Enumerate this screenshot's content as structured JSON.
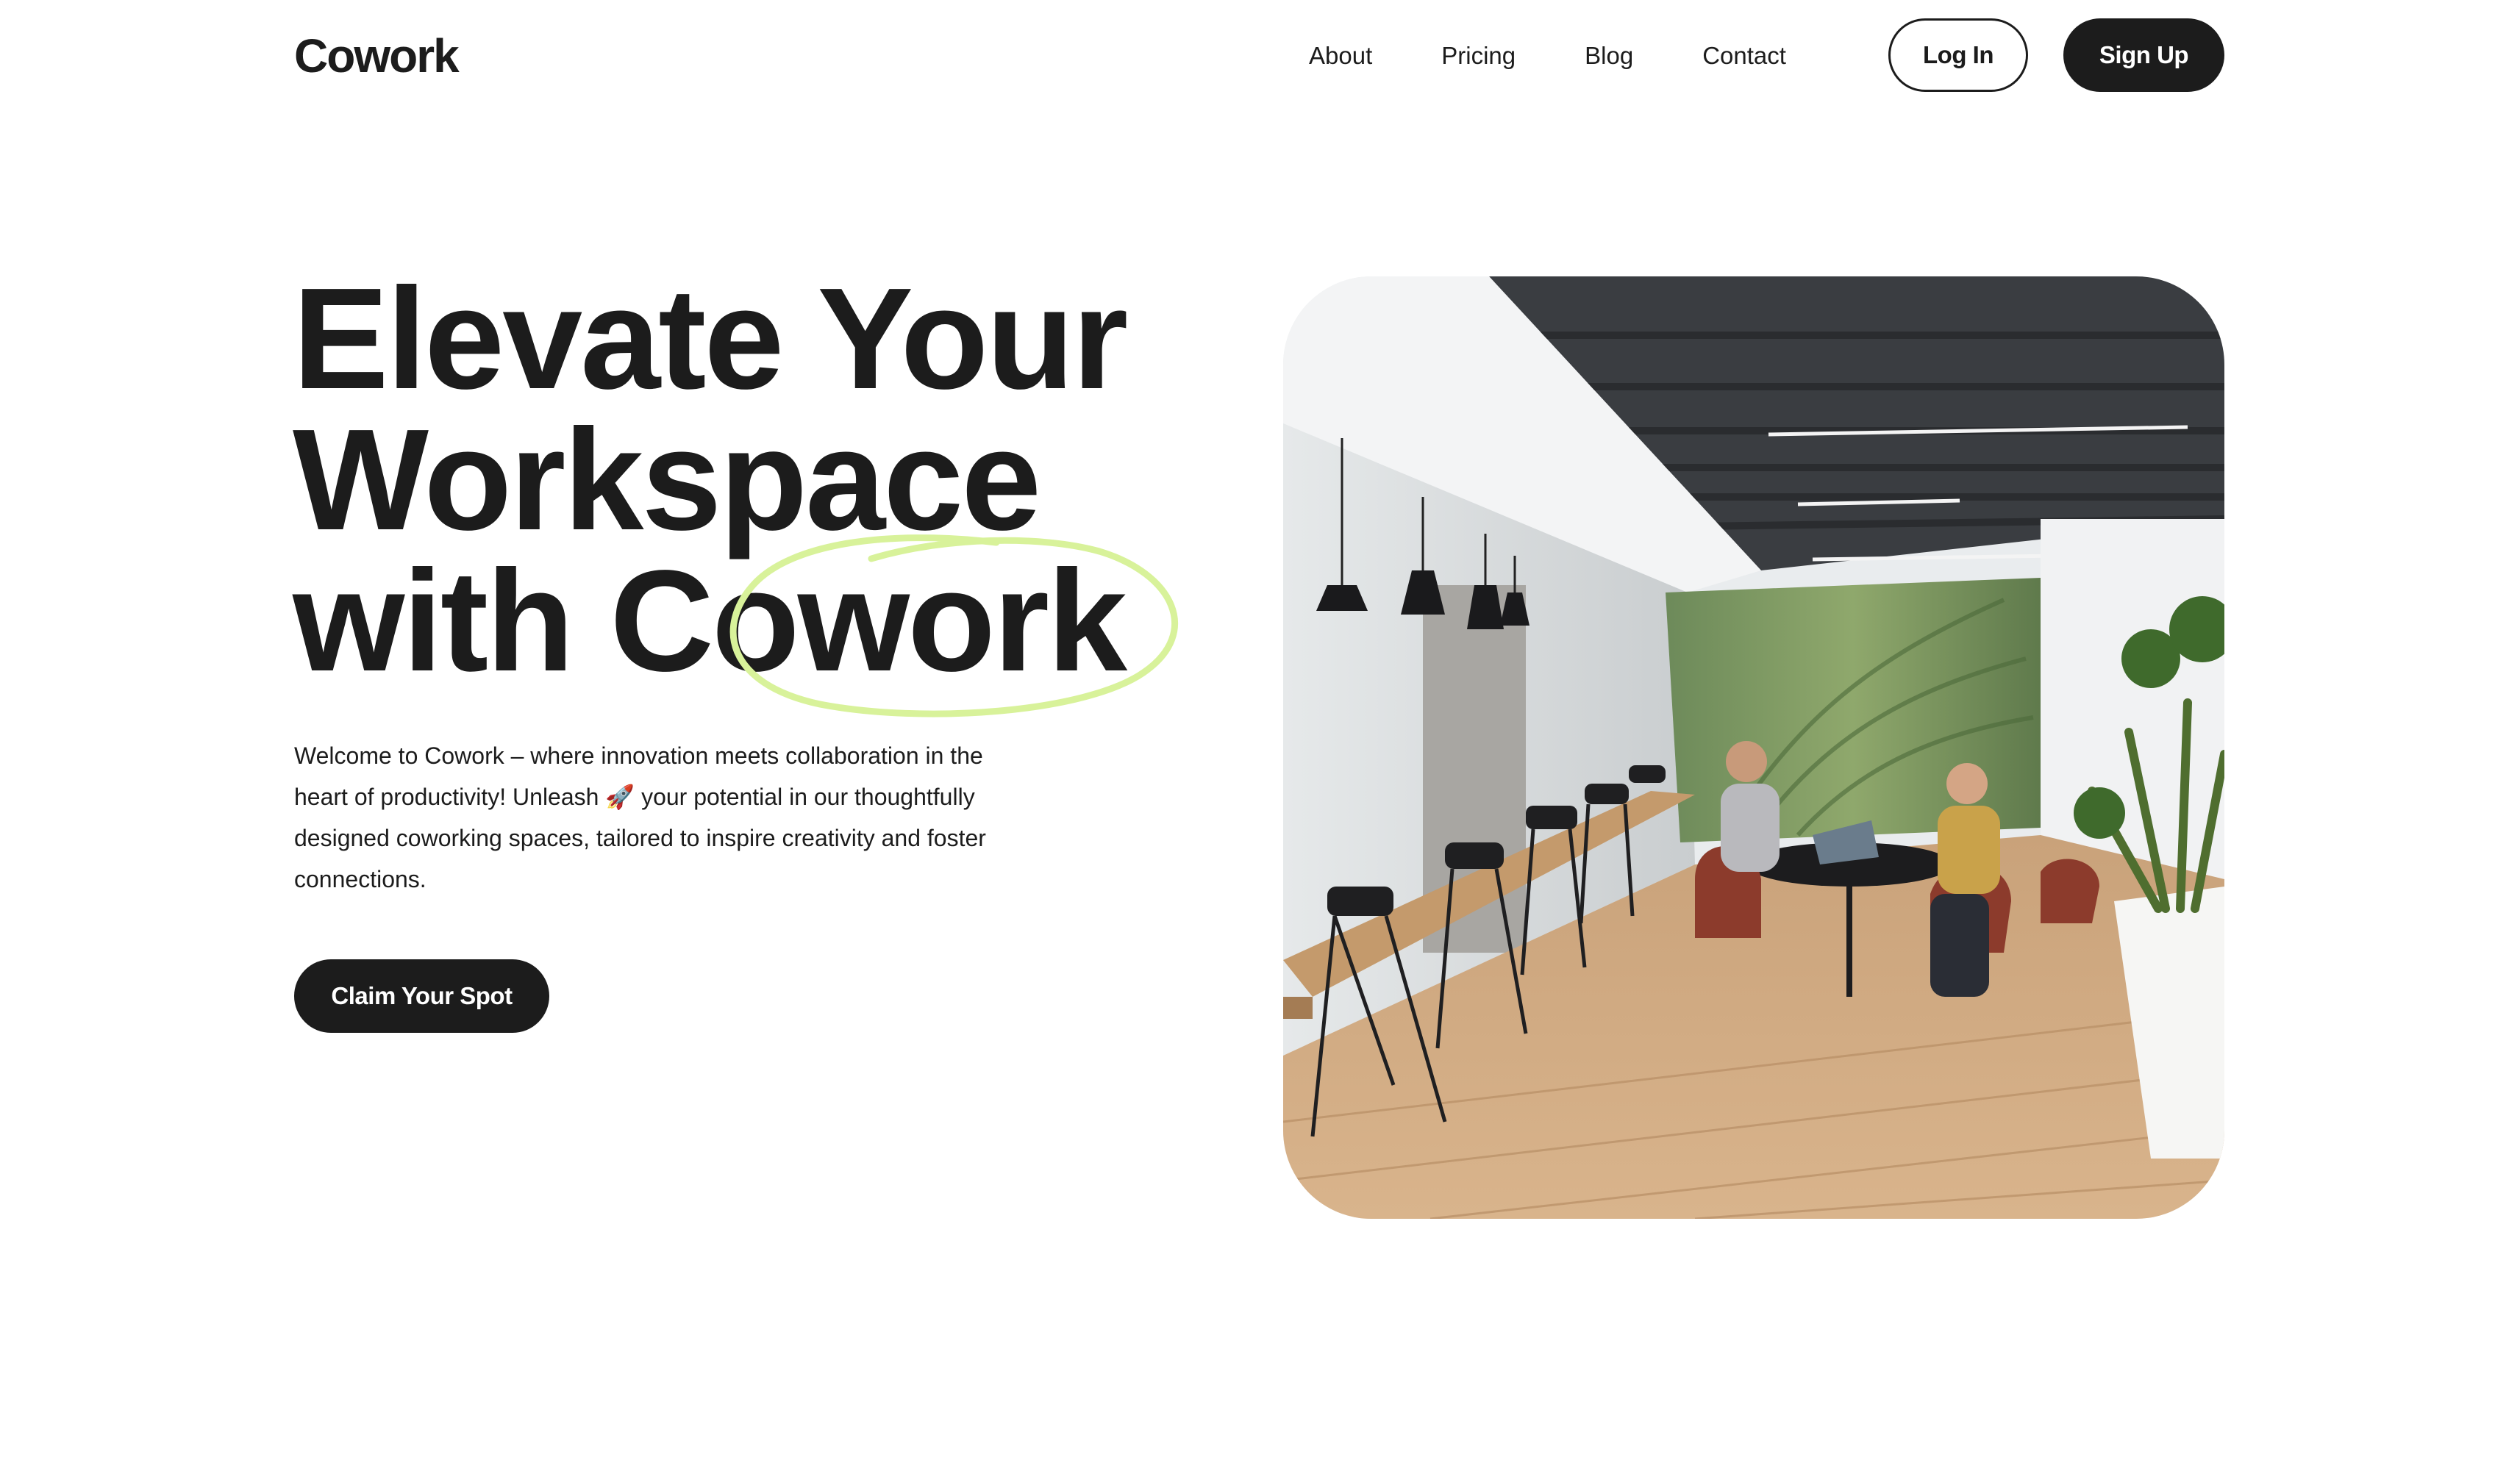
{
  "brand": {
    "name": "Cowork"
  },
  "nav": {
    "links": [
      {
        "label": "About"
      },
      {
        "label": "Pricing"
      },
      {
        "label": "Blog"
      },
      {
        "label": "Contact"
      }
    ],
    "login_label": "Log In",
    "signup_label": "Sign Up"
  },
  "hero": {
    "headline_line1": "Elevate Your",
    "headline_line2": "Workspace",
    "headline_line3_prefix": "with ",
    "headline_line3_highlight": "Cowork",
    "description": "Welcome to Cowork – where innovation meets collaboration in the heart of productivity! Unleash 🚀 your potential in our thoughtfully designed coworking spaces, tailored to inspire creativity and foster connections.",
    "cta_label": "Claim Your Spot",
    "image_icon": "coworking-office-photo"
  },
  "colors": {
    "text": "#1c1c1c",
    "accent_highlight": "#d8f29a",
    "button_dark": "#1c1c1c",
    "background": "#ffffff"
  }
}
